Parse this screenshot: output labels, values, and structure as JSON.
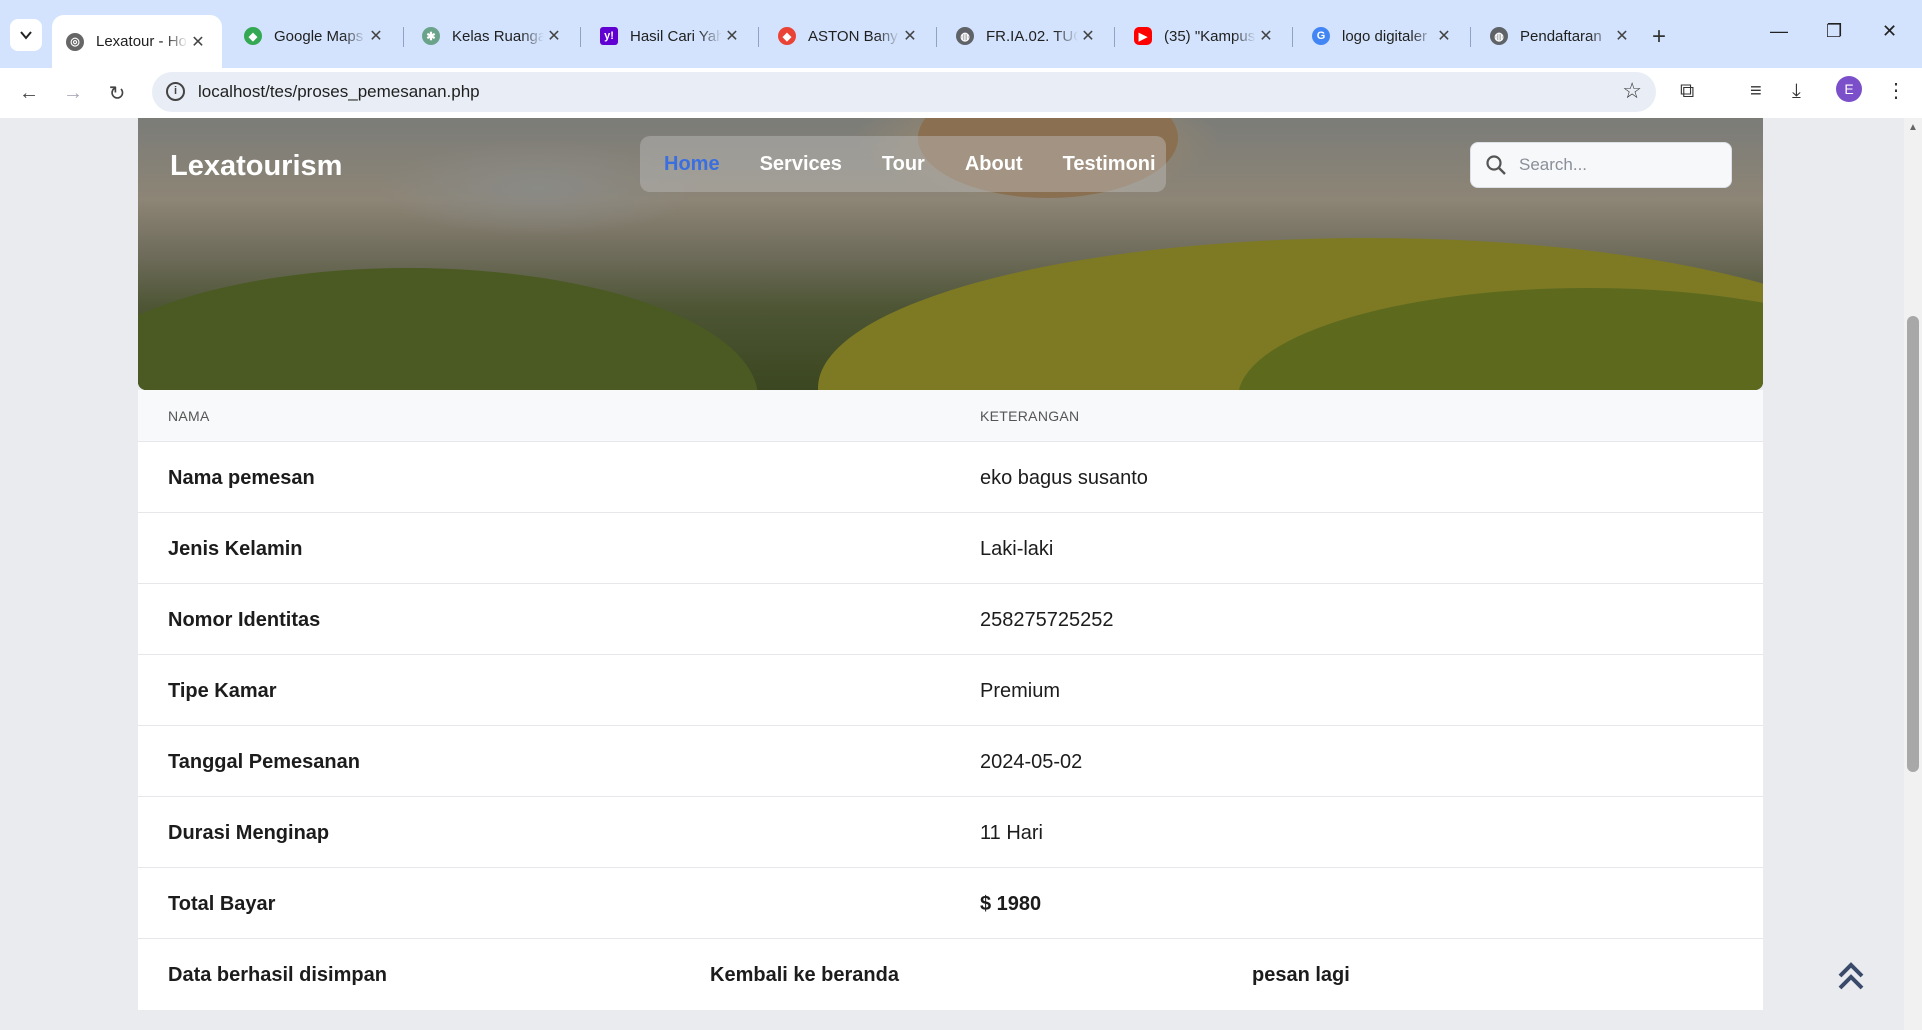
{
  "browser": {
    "tabs": [
      {
        "title": "Lexatour - Ho",
        "active": true,
        "favicon": "lexatour-icon"
      },
      {
        "title": "Google Maps",
        "active": false,
        "favicon": "maps-icon"
      },
      {
        "title": "Kelas Ruanga",
        "active": false,
        "favicon": "classroom-icon"
      },
      {
        "title": "Hasil Cari Yah",
        "active": false,
        "favicon": "yahoo-icon"
      },
      {
        "title": "ASTON Bany",
        "active": false,
        "favicon": "maps-icon"
      },
      {
        "title": "FR.IA.02. TUG",
        "active": false,
        "favicon": "globe-icon"
      },
      {
        "title": "(35) \"Kampus",
        "active": false,
        "favicon": "youtube-icon"
      },
      {
        "title": "logo digitaler",
        "active": false,
        "favicon": "google-icon"
      },
      {
        "title": "Pendaftaran",
        "active": false,
        "favicon": "globe-icon"
      }
    ],
    "url": "localhost/tes/proses_pemesanan.php",
    "profile_initial": "E",
    "colors": {
      "chrome": "#d3e3fd",
      "omnibox": "#e9eef6",
      "avatar": "#7b4fc9"
    }
  },
  "site": {
    "brand": "Lexatourism",
    "nav": [
      {
        "label": "Home",
        "active": true
      },
      {
        "label": "Services",
        "active": false
      },
      {
        "label": "Tour",
        "active": false
      },
      {
        "label": "About",
        "active": false
      },
      {
        "label": "Testimoni",
        "active": false
      }
    ],
    "search": {
      "placeholder": "Search..."
    },
    "colors": {
      "nav_active": "#3b6fe0"
    }
  },
  "table": {
    "headers": [
      "NAMA",
      "KETERANGAN"
    ],
    "rows": [
      {
        "label": "Nama pemesan",
        "value": "eko bagus susanto"
      },
      {
        "label": "Jenis Kelamin",
        "value": "Laki-laki"
      },
      {
        "label": "Nomor Identitas",
        "value": "258275725252"
      },
      {
        "label": "Tipe Kamar",
        "value": "Premium"
      },
      {
        "label": "Tanggal Pemesanan",
        "value": "2024-05-02"
      },
      {
        "label": "Durasi Menginap",
        "value": "11 Hari"
      },
      {
        "label": "Total Bayar",
        "value": "$ 1980"
      }
    ],
    "footer": {
      "status": "Data berhasil disimpan",
      "back_link": "Kembali ke beranda",
      "again_link": "pesan lagi"
    }
  }
}
